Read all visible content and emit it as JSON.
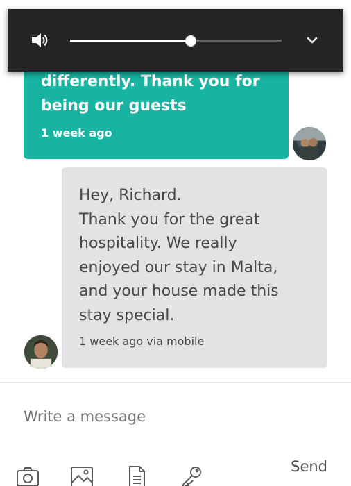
{
  "conversation": {
    "host_message": {
      "text": "differently.  Thank you for\nbeing our guests",
      "time": "1 week ago"
    },
    "guest_message": {
      "text": "Hey, Richard.\nThank you for the great\nhospitality. We really\nenjoyed our stay in Malta,\nand your house made this\nstay special.",
      "time": "1 week ago via mobile"
    }
  },
  "composer": {
    "placeholder": "Write a message",
    "send_label": "Send"
  },
  "toolbar": {
    "icons": [
      "camera-icon",
      "image-icon",
      "document-icon",
      "key-icon"
    ]
  },
  "volume": {
    "level": 0.57,
    "speaker_icon": "speaker-icon",
    "expand_icon": "chevron-down-icon"
  },
  "colors": {
    "host_bubble": "#19b3a1",
    "guest_bubble": "#e3e3e3",
    "text": "#484848",
    "overlay": "#252525"
  }
}
